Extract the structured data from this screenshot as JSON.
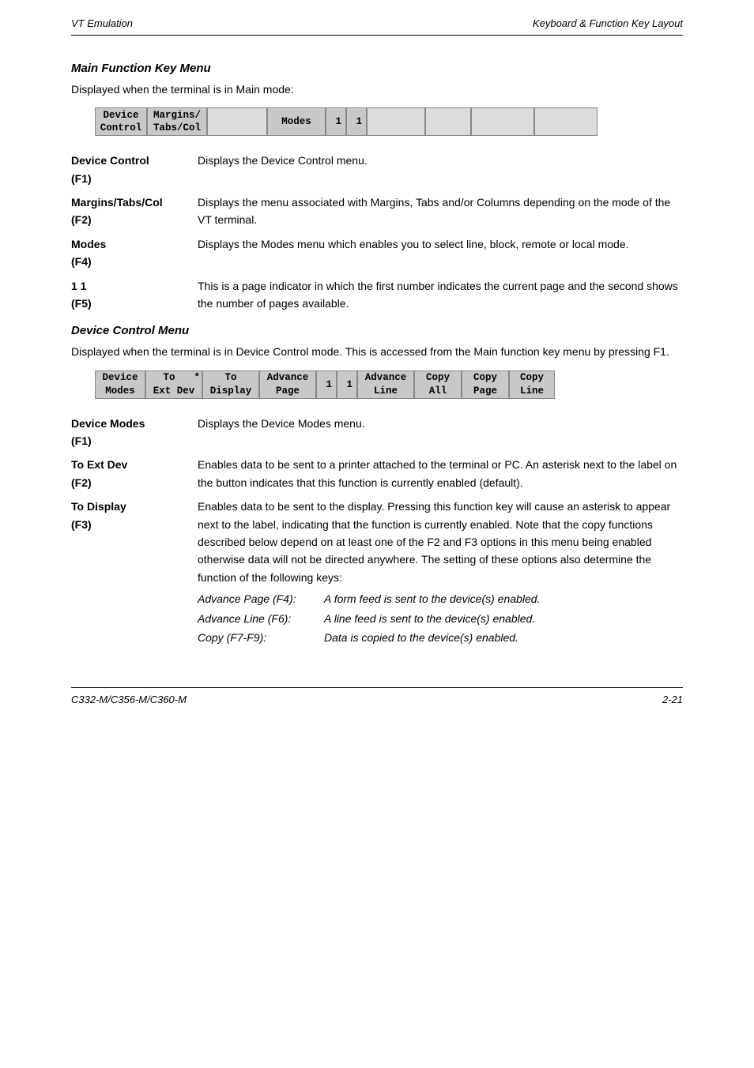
{
  "header": {
    "left": "VT Emulation",
    "right": "Keyboard & Function Key Layout"
  },
  "footer": {
    "left": "C332-M/C356-M/C360-M",
    "right": "2-21"
  },
  "section_main_menu": {
    "title": "Main Function Key Menu",
    "intro": "Displayed when the terminal is in Main mode:"
  },
  "menu1": {
    "f1": {
      "line1": "Device",
      "line2": "Control"
    },
    "f2": {
      "line1": "Margins/",
      "line2": "Tabs/Col"
    },
    "f4": "Modes",
    "f5a": "1",
    "f5b": "1"
  },
  "defs1": [
    {
      "term": "Device Control",
      "sublabel": "(F1)",
      "def": "Displays the Device Control menu."
    },
    {
      "term": "Margins/Tabs/Col",
      "sublabel": "(F2)",
      "def": "Displays the menu associated with Margins, Tabs and/or Columns depending on the mode of the VT terminal."
    },
    {
      "term": "Modes",
      "sublabel": "(F4)",
      "def": "Displays the Modes menu which enables you to select line, block, remote or local mode."
    },
    {
      "term": "1 1",
      "sublabel": "(F5)",
      "def": "This is a page indicator in which the first number indicates the current page and the second shows the number of pages available."
    }
  ],
  "section_dc_menu": {
    "title": "Device Control Menu",
    "intro": "Displayed when the terminal is in Device Control mode. This is accessed from the Main function key menu by pressing F1."
  },
  "menu2": {
    "f1": {
      "line1": "Device",
      "line2": "Modes"
    },
    "f2": {
      "line1": "To",
      "star": "*",
      "line2": "Ext Dev"
    },
    "f3": {
      "line1": "To",
      "line2": "Display"
    },
    "f4": {
      "line1": "Advance",
      "line2": "Page"
    },
    "f5a": "1",
    "f5b": "1",
    "f6": {
      "line1": "Advance",
      "line2": "Line"
    },
    "f7": {
      "line1": "Copy",
      "line2": "All"
    },
    "f8": {
      "line1": "Copy",
      "line2": "Page"
    },
    "f9": {
      "line1": "Copy",
      "line2": "Line"
    }
  },
  "defs2": [
    {
      "term": "Device Modes",
      "sublabel": "(F1)",
      "def": "Displays the Device Modes menu."
    },
    {
      "term": "To Ext Dev",
      "sublabel": "(F2)",
      "def": "Enables data to be sent to a printer attached to the terminal or PC. An asterisk next to the label on the button indicates that this function is currently enabled (default)."
    },
    {
      "term": "To Display",
      "sublabel": "(F3)",
      "def": "Enables data to be sent to the display. Pressing this function key will cause an asterisk to appear next to the label, indicating that the function is currently enabled. Note that the copy functions described below depend on at least one of the F2 and F3 options in this menu being enabled otherwise data will not be directed anywhere. The setting of these options also determine the function of the following keys:"
    }
  ],
  "sublist": [
    {
      "label": "Advance Page (F4):",
      "text": "A form feed is sent to the device(s) enabled."
    },
    {
      "label": "Advance Line (F6):",
      "text": "A line feed is sent to the device(s) enabled."
    },
    {
      "label": "Copy (F7-F9):",
      "text": "Data is copied to the device(s) enabled."
    }
  ]
}
